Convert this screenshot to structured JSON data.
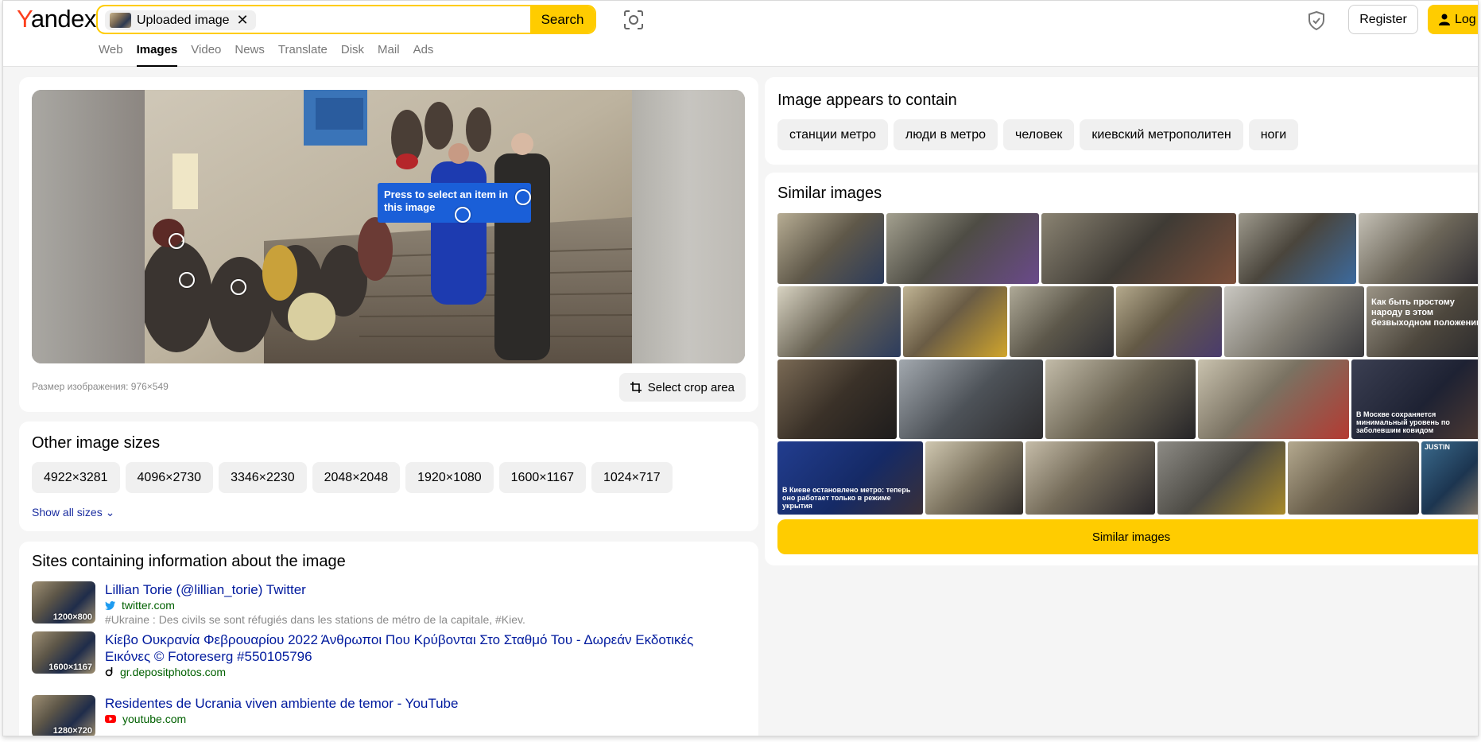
{
  "header": {
    "logo_first": "Y",
    "logo_rest": "andex",
    "search_chip": "Uploaded image",
    "search_button": "Search",
    "register": "Register",
    "login": "Log",
    "nav": [
      "Web",
      "Images",
      "Video",
      "News",
      "Translate",
      "Disk",
      "Mail",
      "Ads"
    ],
    "nav_active": "Images"
  },
  "viewer": {
    "tooltip": "Press to select an item in this image",
    "image_size": "Размер изображения: 976×549",
    "crop_button": "Select crop area"
  },
  "other_sizes": {
    "title": "Other image sizes",
    "sizes": [
      "4922×3281",
      "4096×2730",
      "3346×2230",
      "2048×2048",
      "1920×1080",
      "1600×1167",
      "1024×717"
    ],
    "show_all": "Show all sizes"
  },
  "sites": {
    "title": "Sites containing information about the image",
    "items": [
      {
        "thumb_size": "1200×800",
        "title": "Lillian Torie (@lillian_torie) Twitter",
        "domain": "twitter.com",
        "icon": "twitter-icon",
        "desc": "#Ukraine : Des civils se sont réfugiés dans les stations de métro de la capitale, #Kiev."
      },
      {
        "thumb_size": "1600×1167",
        "title": "Κίεβο Ουκρανία Φεβρουαρίου 2022 Άνθρωποι Που Κρύβονται Στο Σταθμό Του - Δωρεάν Εκδοτικές Εικόνες © Fotoreserg #550105796",
        "domain": "gr.depositphotos.com",
        "icon": "depositphotos-icon",
        "desc": ""
      },
      {
        "thumb_size": "1280×720",
        "title": "Residentes de Ucrania viven ambiente de temor - YouTube",
        "domain": "youtube.com",
        "icon": "youtube-icon",
        "desc": ""
      }
    ]
  },
  "contains": {
    "title": "Image appears to contain",
    "tags": [
      "станции метро",
      "люди в метро",
      "человек",
      "киевский метрополитен",
      "ноги"
    ]
  },
  "similar": {
    "title": "Similar images",
    "button": "Similar images",
    "captions": [
      "Как быть простому народу в этом безвыходном положении",
      "В Москве сохраняется минимальный уровень по заболевшим ковидом",
      "В Киеве остановлено метро: теперь оно работает только в режиме укрытия",
      "JUSTIN"
    ]
  },
  "colors": {
    "accent": "#ffcc00",
    "logo_red": "#fc3f1d",
    "link": "#001a9e",
    "domain_green": "#006000",
    "tooltip_blue": "#1a5fd8"
  }
}
